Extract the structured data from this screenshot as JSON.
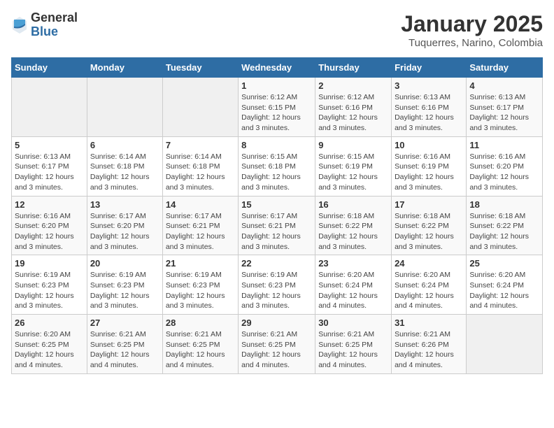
{
  "logo": {
    "general": "General",
    "blue": "Blue"
  },
  "title": "January 2025",
  "subtitle": "Tuquerres, Narino, Colombia",
  "weekdays": [
    "Sunday",
    "Monday",
    "Tuesday",
    "Wednesday",
    "Thursday",
    "Friday",
    "Saturday"
  ],
  "weeks": [
    [
      {
        "day": "",
        "sunrise": "",
        "sunset": "",
        "daylight": ""
      },
      {
        "day": "",
        "sunrise": "",
        "sunset": "",
        "daylight": ""
      },
      {
        "day": "",
        "sunrise": "",
        "sunset": "",
        "daylight": ""
      },
      {
        "day": "1",
        "sunrise": "Sunrise: 6:12 AM",
        "sunset": "Sunset: 6:15 PM",
        "daylight": "Daylight: 12 hours and 3 minutes."
      },
      {
        "day": "2",
        "sunrise": "Sunrise: 6:12 AM",
        "sunset": "Sunset: 6:16 PM",
        "daylight": "Daylight: 12 hours and 3 minutes."
      },
      {
        "day": "3",
        "sunrise": "Sunrise: 6:13 AM",
        "sunset": "Sunset: 6:16 PM",
        "daylight": "Daylight: 12 hours and 3 minutes."
      },
      {
        "day": "4",
        "sunrise": "Sunrise: 6:13 AM",
        "sunset": "Sunset: 6:17 PM",
        "daylight": "Daylight: 12 hours and 3 minutes."
      }
    ],
    [
      {
        "day": "5",
        "sunrise": "Sunrise: 6:13 AM",
        "sunset": "Sunset: 6:17 PM",
        "daylight": "Daylight: 12 hours and 3 minutes."
      },
      {
        "day": "6",
        "sunrise": "Sunrise: 6:14 AM",
        "sunset": "Sunset: 6:18 PM",
        "daylight": "Daylight: 12 hours and 3 minutes."
      },
      {
        "day": "7",
        "sunrise": "Sunrise: 6:14 AM",
        "sunset": "Sunset: 6:18 PM",
        "daylight": "Daylight: 12 hours and 3 minutes."
      },
      {
        "day": "8",
        "sunrise": "Sunrise: 6:15 AM",
        "sunset": "Sunset: 6:18 PM",
        "daylight": "Daylight: 12 hours and 3 minutes."
      },
      {
        "day": "9",
        "sunrise": "Sunrise: 6:15 AM",
        "sunset": "Sunset: 6:19 PM",
        "daylight": "Daylight: 12 hours and 3 minutes."
      },
      {
        "day": "10",
        "sunrise": "Sunrise: 6:16 AM",
        "sunset": "Sunset: 6:19 PM",
        "daylight": "Daylight: 12 hours and 3 minutes."
      },
      {
        "day": "11",
        "sunrise": "Sunrise: 6:16 AM",
        "sunset": "Sunset: 6:20 PM",
        "daylight": "Daylight: 12 hours and 3 minutes."
      }
    ],
    [
      {
        "day": "12",
        "sunrise": "Sunrise: 6:16 AM",
        "sunset": "Sunset: 6:20 PM",
        "daylight": "Daylight: 12 hours and 3 minutes."
      },
      {
        "day": "13",
        "sunrise": "Sunrise: 6:17 AM",
        "sunset": "Sunset: 6:20 PM",
        "daylight": "Daylight: 12 hours and 3 minutes."
      },
      {
        "day": "14",
        "sunrise": "Sunrise: 6:17 AM",
        "sunset": "Sunset: 6:21 PM",
        "daylight": "Daylight: 12 hours and 3 minutes."
      },
      {
        "day": "15",
        "sunrise": "Sunrise: 6:17 AM",
        "sunset": "Sunset: 6:21 PM",
        "daylight": "Daylight: 12 hours and 3 minutes."
      },
      {
        "day": "16",
        "sunrise": "Sunrise: 6:18 AM",
        "sunset": "Sunset: 6:22 PM",
        "daylight": "Daylight: 12 hours and 3 minutes."
      },
      {
        "day": "17",
        "sunrise": "Sunrise: 6:18 AM",
        "sunset": "Sunset: 6:22 PM",
        "daylight": "Daylight: 12 hours and 3 minutes."
      },
      {
        "day": "18",
        "sunrise": "Sunrise: 6:18 AM",
        "sunset": "Sunset: 6:22 PM",
        "daylight": "Daylight: 12 hours and 3 minutes."
      }
    ],
    [
      {
        "day": "19",
        "sunrise": "Sunrise: 6:19 AM",
        "sunset": "Sunset: 6:23 PM",
        "daylight": "Daylight: 12 hours and 3 minutes."
      },
      {
        "day": "20",
        "sunrise": "Sunrise: 6:19 AM",
        "sunset": "Sunset: 6:23 PM",
        "daylight": "Daylight: 12 hours and 3 minutes."
      },
      {
        "day": "21",
        "sunrise": "Sunrise: 6:19 AM",
        "sunset": "Sunset: 6:23 PM",
        "daylight": "Daylight: 12 hours and 3 minutes."
      },
      {
        "day": "22",
        "sunrise": "Sunrise: 6:19 AM",
        "sunset": "Sunset: 6:23 PM",
        "daylight": "Daylight: 12 hours and 3 minutes."
      },
      {
        "day": "23",
        "sunrise": "Sunrise: 6:20 AM",
        "sunset": "Sunset: 6:24 PM",
        "daylight": "Daylight: 12 hours and 4 minutes."
      },
      {
        "day": "24",
        "sunrise": "Sunrise: 6:20 AM",
        "sunset": "Sunset: 6:24 PM",
        "daylight": "Daylight: 12 hours and 4 minutes."
      },
      {
        "day": "25",
        "sunrise": "Sunrise: 6:20 AM",
        "sunset": "Sunset: 6:24 PM",
        "daylight": "Daylight: 12 hours and 4 minutes."
      }
    ],
    [
      {
        "day": "26",
        "sunrise": "Sunrise: 6:20 AM",
        "sunset": "Sunset: 6:25 PM",
        "daylight": "Daylight: 12 hours and 4 minutes."
      },
      {
        "day": "27",
        "sunrise": "Sunrise: 6:21 AM",
        "sunset": "Sunset: 6:25 PM",
        "daylight": "Daylight: 12 hours and 4 minutes."
      },
      {
        "day": "28",
        "sunrise": "Sunrise: 6:21 AM",
        "sunset": "Sunset: 6:25 PM",
        "daylight": "Daylight: 12 hours and 4 minutes."
      },
      {
        "day": "29",
        "sunrise": "Sunrise: 6:21 AM",
        "sunset": "Sunset: 6:25 PM",
        "daylight": "Daylight: 12 hours and 4 minutes."
      },
      {
        "day": "30",
        "sunrise": "Sunrise: 6:21 AM",
        "sunset": "Sunset: 6:25 PM",
        "daylight": "Daylight: 12 hours and 4 minutes."
      },
      {
        "day": "31",
        "sunrise": "Sunrise: 6:21 AM",
        "sunset": "Sunset: 6:26 PM",
        "daylight": "Daylight: 12 hours and 4 minutes."
      },
      {
        "day": "",
        "sunrise": "",
        "sunset": "",
        "daylight": ""
      }
    ]
  ]
}
